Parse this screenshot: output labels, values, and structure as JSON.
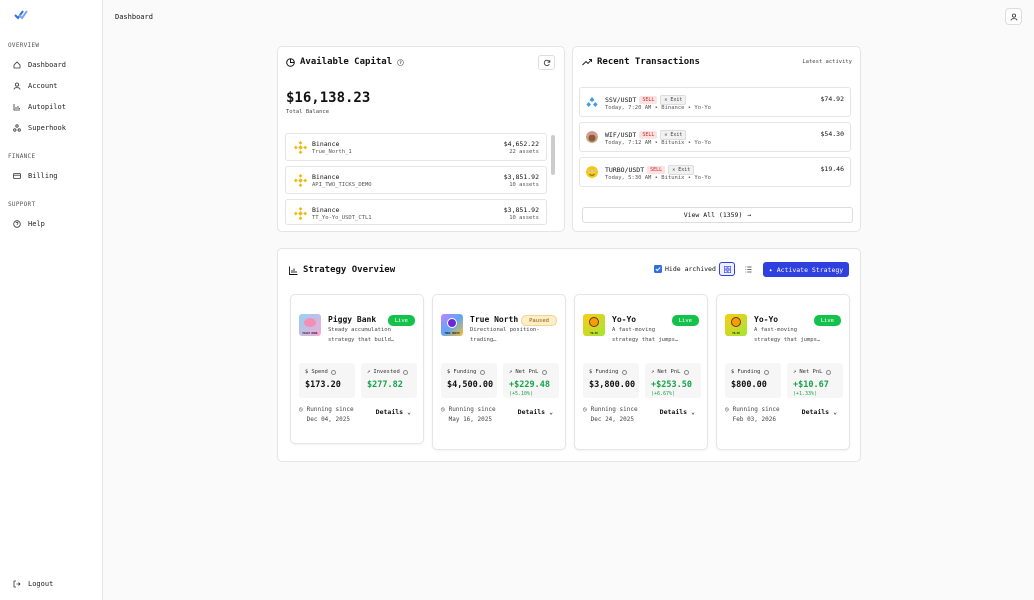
{
  "sidebar": {
    "sections": [
      {
        "label": "OVERVIEW",
        "items": [
          {
            "label": "Dashboard",
            "icon": "home-icon"
          },
          {
            "label": "Account",
            "icon": "user-icon"
          },
          {
            "label": "Autopilot",
            "icon": "chart-icon"
          },
          {
            "label": "Superhook",
            "icon": "hook-icon"
          }
        ]
      },
      {
        "label": "FINANCE",
        "items": [
          {
            "label": "Billing",
            "icon": "card-icon"
          }
        ]
      },
      {
        "label": "SUPPORT",
        "items": [
          {
            "label": "Help",
            "icon": "help-icon"
          }
        ]
      }
    ],
    "logout": "Logout"
  },
  "header": {
    "title": "Dashboard"
  },
  "capital": {
    "title": "Available Capital",
    "total": "$16,138.23",
    "total_label": "Total Balance",
    "accounts": [
      {
        "exchange": "Binance",
        "name": "True_North_1",
        "amount": "$4,652.22",
        "assets": "22 assets"
      },
      {
        "exchange": "Binance",
        "name": "API_TWO_TICKS_DEMO",
        "amount": "$3,851.92",
        "assets": "10 assets"
      },
      {
        "exchange": "Binance",
        "name": "TT_Yo-Yo_USDT_CTL1",
        "amount": "$3,851.92",
        "assets": "10 assets"
      }
    ]
  },
  "transactions": {
    "title": "Recent Transactions",
    "subtitle": "Latest activity",
    "items": [
      {
        "pair": "SSV/USDT",
        "side": "SELL",
        "tag": "Exit",
        "meta": "Today, 7:20 AM • Binance • Yo-Yo",
        "amount": "$74.92",
        "icon_color": "#3b82f6"
      },
      {
        "pair": "WIF/USDT",
        "side": "SELL",
        "tag": "Exit",
        "meta": "Today, 7:12 AM • Bitunix • Yo-Yo",
        "amount": "$54.30",
        "icon_color": "#a0785a"
      },
      {
        "pair": "TURBO/USDT",
        "side": "SELL",
        "tag": "Exit",
        "meta": "Today, 5:30 AM • Bitunix • Yo-Yo",
        "amount": "$19.46",
        "icon_color": "#f5c518"
      }
    ],
    "view_all": "View All (1359)"
  },
  "strategy": {
    "title": "Strategy Overview",
    "hide_archived": "Hide archived",
    "activate": "Activate Strategy",
    "cards": [
      {
        "name": "Piggy Bank",
        "desc": "Steady accumulation strategy that build…",
        "status": "Live",
        "m1_label": "Spend",
        "m1_value": "$173.20",
        "m2_label": "Invested",
        "m2_value": "$277.82",
        "m2_pct": "",
        "since_label": "Running since",
        "since_date": "Dec 04, 2025",
        "details": "Details",
        "avatar_text": "PIGGY BANK"
      },
      {
        "name": "True North",
        "desc": "Directional position-trading…",
        "status": "Paused",
        "m1_label": "Funding",
        "m1_value": "$4,500.00",
        "m2_label": "Net PnL",
        "m2_value": "+$229.48",
        "m2_pct": "(+5.10%)",
        "since_label": "Running since",
        "since_date": "May 16, 2025",
        "details": "Details",
        "avatar_text": "TRUE NORTH"
      },
      {
        "name": "Yo-Yo",
        "desc": "A fast-moving strategy that jumps…",
        "status": "Live",
        "m1_label": "Funding",
        "m1_value": "$3,800.00",
        "m2_label": "Net PnL",
        "m2_value": "+$253.50",
        "m2_pct": "(+6.67%)",
        "since_label": "Running since",
        "since_date": "Dec 24, 2025",
        "details": "Details",
        "avatar_text": "YO-YO"
      },
      {
        "name": "Yo-Yo",
        "desc": "A fast-moving strategy that jumps…",
        "status": "Live",
        "m1_label": "Funding",
        "m1_value": "$800.00",
        "m2_label": "Net PnL",
        "m2_value": "+$10.67",
        "m2_pct": "(+1.33%)",
        "since_label": "Running since",
        "since_date": "Feb 03, 2026",
        "details": "Details",
        "avatar_text": "YO-YO"
      }
    ]
  },
  "colors": {
    "accent": "#2f3fe0",
    "live": "#12c24b",
    "sell": "#c92a2a"
  }
}
